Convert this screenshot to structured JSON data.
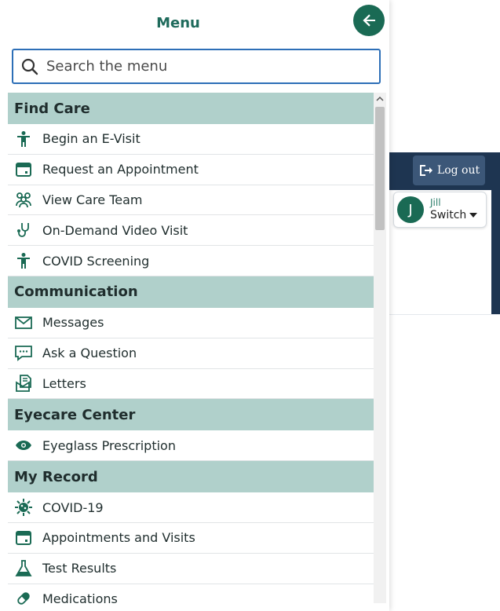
{
  "app": {
    "logout_label": "Log out",
    "user": {
      "initial": "J",
      "name": "Jill",
      "switch_label": "Switch"
    }
  },
  "menu": {
    "title": "Menu",
    "search_placeholder": "Search the menu",
    "sections": [
      {
        "title": "Find Care",
        "items": [
          {
            "label": "Begin an E-Visit",
            "icon": "person-icon"
          },
          {
            "label": "Request an Appointment",
            "icon": "calendar-icon"
          },
          {
            "label": "View Care Team",
            "icon": "care-team-icon"
          },
          {
            "label": "On-Demand Video Visit",
            "icon": "stethoscope-icon"
          },
          {
            "label": "COVID Screening",
            "icon": "person-icon"
          }
        ]
      },
      {
        "title": "Communication",
        "items": [
          {
            "label": "Messages",
            "icon": "envelope-icon"
          },
          {
            "label": "Ask a Question",
            "icon": "chat-icon"
          },
          {
            "label": "Letters",
            "icon": "letters-icon"
          }
        ]
      },
      {
        "title": "Eyecare Center",
        "items": [
          {
            "label": "Eyeglass Prescription",
            "icon": "eye-icon"
          }
        ]
      },
      {
        "title": "My Record",
        "items": [
          {
            "label": "COVID-19",
            "icon": "virus-icon"
          },
          {
            "label": "Appointments and Visits",
            "icon": "calendar-icon"
          },
          {
            "label": "Test Results",
            "icon": "flask-icon"
          },
          {
            "label": "Medications",
            "icon": "pill-icon"
          }
        ]
      }
    ]
  },
  "colors": {
    "accent": "#1a6a54",
    "section_bg": "#b0d0cb",
    "header_bg": "#1e3551",
    "search_border": "#2d6fb7"
  }
}
